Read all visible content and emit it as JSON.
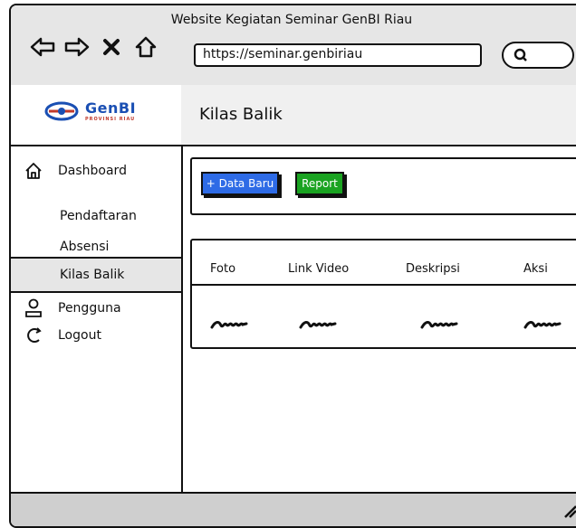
{
  "window": {
    "title": "Website Kegiatan Seminar GenBI Riau"
  },
  "browser": {
    "url": "https://seminar.genbiriau"
  },
  "sidebar": {
    "logo": {
      "brand": "GenBI",
      "subtitle": "PROVINSI RIAU"
    },
    "items": [
      {
        "label": "Dashboard",
        "icon": "home-icon"
      },
      {
        "label": "Pendaftaran"
      },
      {
        "label": "Absensi"
      },
      {
        "label": "Kilas Balik",
        "active": true
      },
      {
        "label": "Pengguna",
        "icon": "user-icon"
      },
      {
        "label": "Logout",
        "icon": "logout-icon"
      }
    ]
  },
  "page": {
    "title": "Kilas Balik"
  },
  "toolbar": {
    "add_label": "+ Data Baru",
    "report_label": "Report"
  },
  "table": {
    "columns": [
      "Foto",
      "Link Video",
      "Deskripsi",
      "Aksi"
    ]
  },
  "colors": {
    "primary_button": "#2e6be6",
    "report_button": "#1aa321",
    "header_bg": "#f0f0f0"
  }
}
